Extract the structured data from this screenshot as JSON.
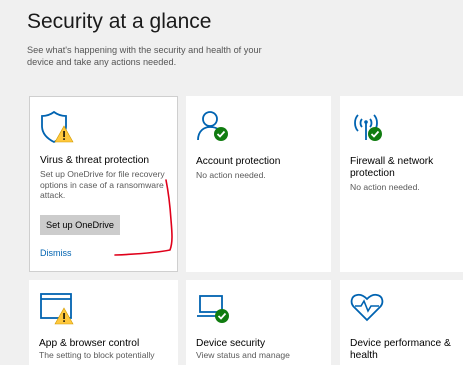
{
  "page": {
    "title": "Security at a glance",
    "subtitle": "See what's happening with the security and health of your device and take any actions needed."
  },
  "tiles": [
    {
      "icon": "shield-warning-icon",
      "title": "Virus & threat protection",
      "description": "Set up OneDrive for file recovery options in case of a ransomware attack.",
      "action_label": "Set up OneDrive",
      "dismiss_label": "Dismiss",
      "status": "warning"
    },
    {
      "icon": "account-check-icon",
      "title": "Account protection",
      "description": "No action needed.",
      "status": "ok"
    },
    {
      "icon": "wifi-check-icon",
      "title": "Firewall & network protection",
      "description": "No action needed.",
      "status": "ok"
    },
    {
      "icon": "browser-warning-icon",
      "title": "App & browser control",
      "description": "The setting to block potentially",
      "status": "warning"
    },
    {
      "icon": "laptop-check-icon",
      "title": "Device security",
      "description": "View status and manage",
      "status": "ok"
    },
    {
      "icon": "heart-pulse-icon",
      "title": "Device performance & health",
      "description": "",
      "status": "ok"
    }
  ],
  "colors": {
    "accent": "#0063b1",
    "ok": "#107c10",
    "warning": "#ffc83d",
    "annotation": "#e0001a"
  }
}
